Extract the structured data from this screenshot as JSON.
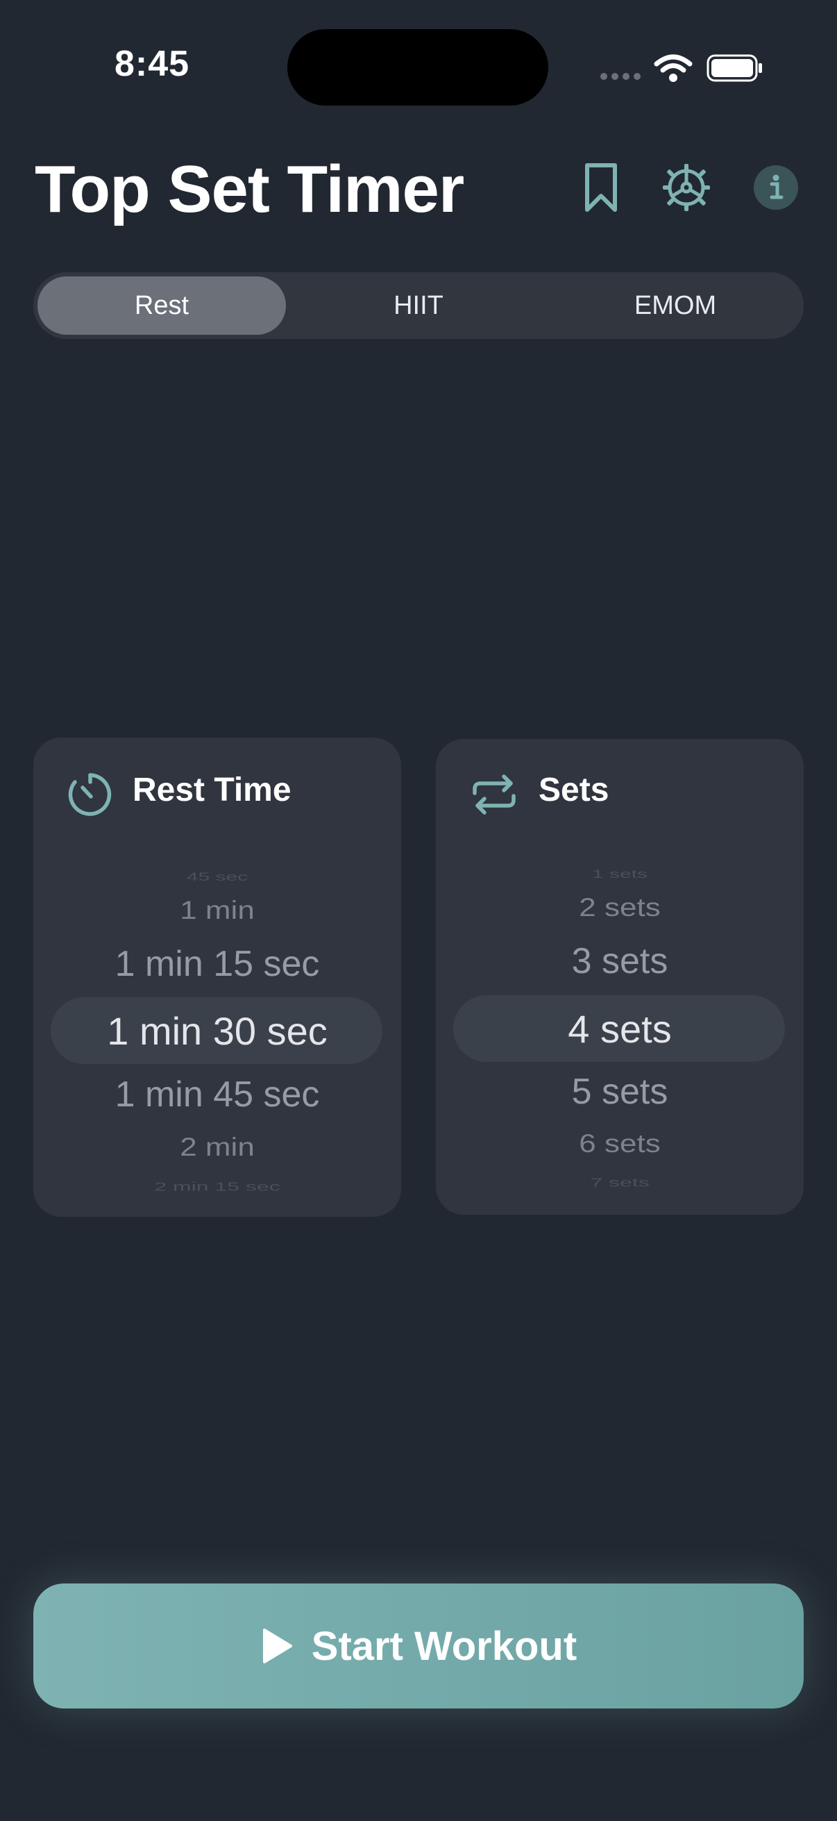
{
  "status_bar": {
    "time": "8:45"
  },
  "header": {
    "title": "Top Set Timer",
    "icons": [
      "bookmark-icon",
      "gear-icon",
      "info-icon"
    ]
  },
  "tabs": [
    {
      "label": "Rest",
      "active": true
    },
    {
      "label": "HIIT",
      "active": false
    },
    {
      "label": "EMOM",
      "active": false
    }
  ],
  "rest_card": {
    "title": "Rest Time",
    "icon": "timer-icon",
    "options": [
      "45 sec",
      "1 min",
      "1 min 15 sec",
      "1 min 30 sec",
      "1 min 45 sec",
      "2 min",
      "2 min 15 sec"
    ],
    "selected": "1 min 30 sec"
  },
  "sets_card": {
    "title": "Sets",
    "icon": "repeat-icon",
    "options": [
      "1 sets",
      "2 sets",
      "3 sets",
      "4 sets",
      "5 sets",
      "6 sets",
      "7 sets"
    ],
    "selected": "4 sets"
  },
  "start_button": {
    "label": "Start Workout",
    "icon": "play-icon"
  },
  "colors": {
    "background": "#222831",
    "card": "#30353f",
    "accent": "#7fb3b3",
    "active_tab": "#6b7079"
  }
}
